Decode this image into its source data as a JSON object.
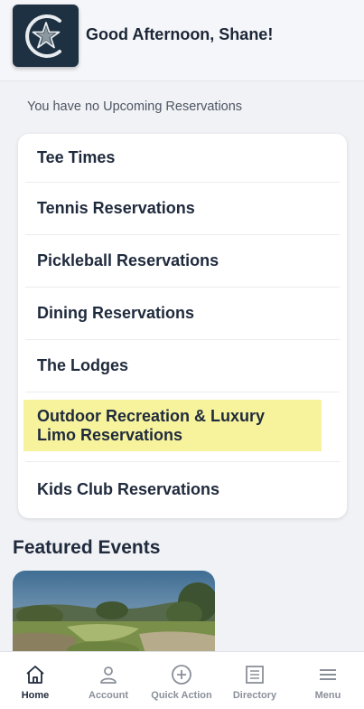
{
  "header": {
    "greeting": "Good Afternoon, Shane!"
  },
  "reservations_notice": "You have no Upcoming Reservations",
  "reservation_menu": {
    "items": [
      {
        "label": "Tee Times"
      },
      {
        "label": "Tennis Reservations"
      },
      {
        "label": "Pickleball Reservations"
      },
      {
        "label": "Dining Reservations"
      },
      {
        "label": "The Lodges"
      },
      {
        "label": "Outdoor Recreation & Luxury Limo Reservations",
        "highlighted": true
      },
      {
        "label": "Kids Club Reservations"
      }
    ]
  },
  "featured": {
    "title": "Featured Events"
  },
  "tabbar": {
    "tabs": [
      {
        "label": "Home",
        "icon": "home-icon",
        "active": true
      },
      {
        "label": "Account",
        "icon": "person-icon"
      },
      {
        "label": "Quick Action",
        "icon": "plus-circle-icon"
      },
      {
        "label": "Directory",
        "icon": "list-icon"
      },
      {
        "label": "Menu",
        "icon": "hamburger-icon"
      }
    ]
  },
  "colors": {
    "logo_bg": "#1e3142",
    "highlight": "#f7f39d",
    "text_dark": "#1f2a3c",
    "tab_inactive": "#8a909a"
  }
}
